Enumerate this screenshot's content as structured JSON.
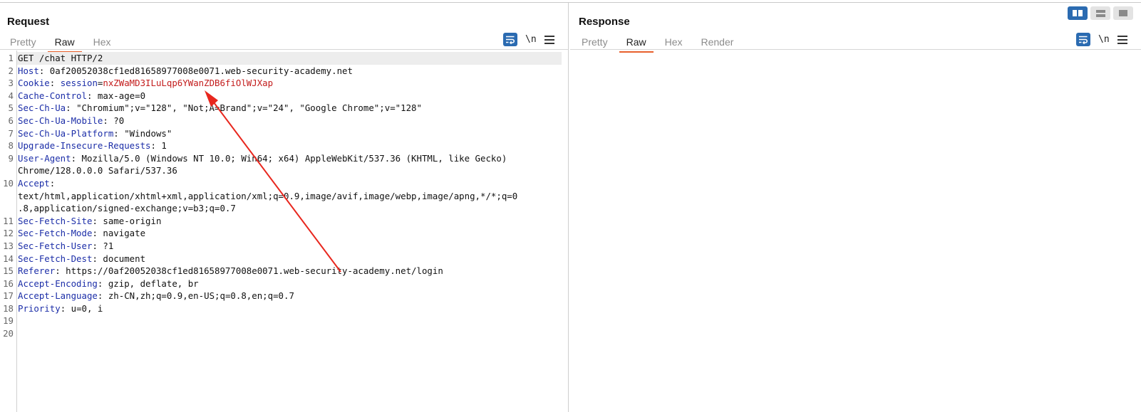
{
  "layout_toggle": {
    "selected": "side-by-side"
  },
  "request": {
    "title": "Request",
    "tabs": [
      {
        "label": "Pretty",
        "active": false
      },
      {
        "label": "Raw",
        "active": true
      },
      {
        "label": "Hex",
        "active": false
      }
    ],
    "tools": {
      "wrap_icon": "wrap-lines-icon",
      "newline_label": "\\n",
      "menu_icon": "hamburger-menu-icon"
    },
    "lines": [
      {
        "n": "1",
        "text": "GET /chat HTTP/2"
      },
      {
        "n": "2",
        "key": "Host",
        "value": "0af20052038cf1ed81658977008e0071.web-security-academy.net"
      },
      {
        "n": "3",
        "key": "Cookie",
        "cookie_name": "session",
        "cookie_value": "nxZWaMD3ILuLqp6YWanZDB6fiOlWJXap"
      },
      {
        "n": "4",
        "key": "Cache-Control",
        "value": "max-age=0"
      },
      {
        "n": "5",
        "key": "Sec-Ch-Ua",
        "value": "\"Chromium\";v=\"128\", \"Not;A=Brand\";v=\"24\", \"Google Chrome\";v=\"128\""
      },
      {
        "n": "6",
        "key": "Sec-Ch-Ua-Mobile",
        "value": "?0"
      },
      {
        "n": "7",
        "key": "Sec-Ch-Ua-Platform",
        "value": "\"Windows\""
      },
      {
        "n": "8",
        "key": "Upgrade-Insecure-Requests",
        "value": "1"
      },
      {
        "n": "9",
        "key": "User-Agent",
        "value": "Mozilla/5.0 (Windows NT 10.0; Win64; x64) AppleWebKit/537.36 (KHTML, like Gecko)"
      },
      {
        "n": "",
        "text": "Chrome/128.0.0.0 Safari/537.36"
      },
      {
        "n": "10",
        "key": "Accept",
        "value": ""
      },
      {
        "n": "",
        "text": "text/html,application/xhtml+xml,application/xml;q=0.9,image/avif,image/webp,image/apng,*/*;q=0"
      },
      {
        "n": "",
        "text": ".8,application/signed-exchange;v=b3;q=0.7"
      },
      {
        "n": "11",
        "key": "Sec-Fetch-Site",
        "value": "same-origin"
      },
      {
        "n": "12",
        "key": "Sec-Fetch-Mode",
        "value": "navigate"
      },
      {
        "n": "13",
        "key": "Sec-Fetch-User",
        "value": "?1"
      },
      {
        "n": "14",
        "key": "Sec-Fetch-Dest",
        "value": "document"
      },
      {
        "n": "15",
        "key": "Referer",
        "value": "https://0af20052038cf1ed81658977008e0071.web-security-academy.net/login"
      },
      {
        "n": "16",
        "key": "Accept-Encoding",
        "value": "gzip, deflate, br"
      },
      {
        "n": "17",
        "key": "Accept-Language",
        "value": "zh-CN,zh;q=0.9,en-US;q=0.8,en;q=0.7"
      },
      {
        "n": "18",
        "key": "Priority",
        "value": "u=0, i"
      },
      {
        "n": "19",
        "text": ""
      },
      {
        "n": "20",
        "text": ""
      }
    ]
  },
  "response": {
    "title": "Response",
    "tabs": [
      {
        "label": "Pretty",
        "active": false
      },
      {
        "label": "Raw",
        "active": true
      },
      {
        "label": "Hex",
        "active": false
      },
      {
        "label": "Render",
        "active": false
      }
    ],
    "tools": {
      "wrap_icon": "wrap-lines-icon",
      "newline_label": "\\n",
      "menu_icon": "hamburger-menu-icon"
    }
  },
  "colors": {
    "accent_tab": "#e8602c",
    "header_key": "#1c2ea8",
    "cookie_value": "#c31c1c",
    "annotation_arrow": "#e8271e",
    "tool_blue": "#2b6bb1"
  }
}
